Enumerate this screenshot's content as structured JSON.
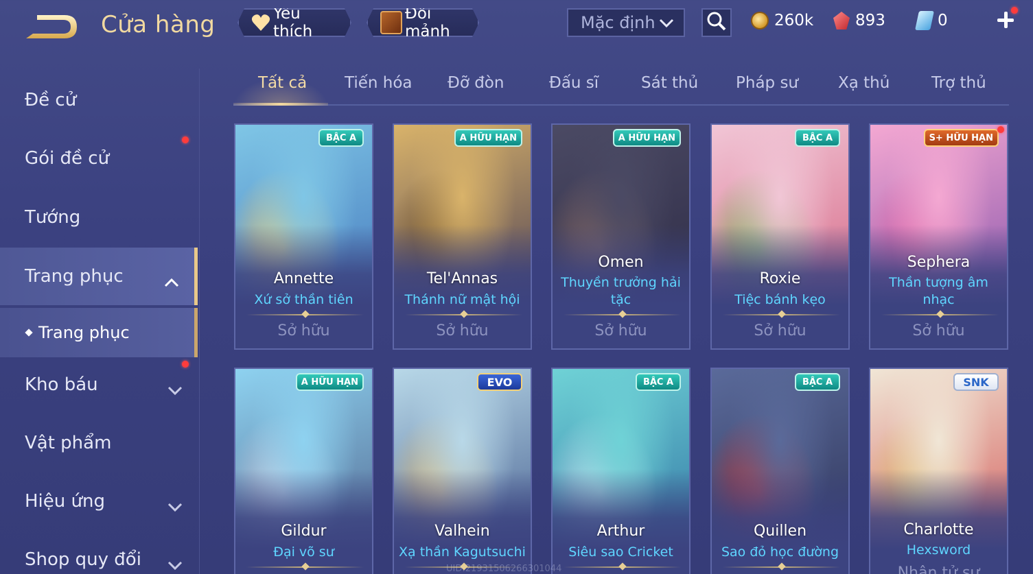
{
  "header": {
    "title": "Cửa hàng",
    "favorite_label": "Yêu thích",
    "shard_label": "Đổi mảnh",
    "sort_value": "Mặc định",
    "currencies": {
      "gold": "260k",
      "ruby": "893",
      "voucher": "0"
    }
  },
  "sidebar": {
    "items": [
      {
        "label": "Đề cử"
      },
      {
        "label": "Gói đề cử"
      },
      {
        "label": "Tướng"
      },
      {
        "label": "Trang phục"
      },
      {
        "label": "Trang phục"
      },
      {
        "label": "Kho báu"
      },
      {
        "label": "Vật phẩm"
      },
      {
        "label": "Hiệu ứng"
      },
      {
        "label": "Shop quy đổi"
      }
    ]
  },
  "tabs": [
    {
      "label": "Tất cả"
    },
    {
      "label": "Tiến hóa"
    },
    {
      "label": "Đỡ đòn"
    },
    {
      "label": "Đấu sĩ"
    },
    {
      "label": "Sát thủ"
    },
    {
      "label": "Pháp sư"
    },
    {
      "label": "Xạ thủ"
    },
    {
      "label": "Trợ thủ"
    }
  ],
  "cards": [
    {
      "hero": "Annette",
      "skin": "Xứ sở thần tiên",
      "status": "Sở hữu",
      "badge": "BẬC A",
      "art_colors": [
        "#7fc6e6",
        "#f0d27a",
        "#3e6fb8"
      ]
    },
    {
      "hero": "Tel'Annas",
      "skin": "Thánh nữ mật hội",
      "status": "Sở hữu",
      "badge": "A HỮU HẠN",
      "art_colors": [
        "#d9b36a",
        "#7a5a2c",
        "#3a3152"
      ]
    },
    {
      "hero": "Omen",
      "skin": "Thuyền trưởng hải tặc",
      "status": "Sở hữu",
      "badge": "A HỮU HẠN",
      "art_colors": [
        "#4b4a64",
        "#8a6c64",
        "#2a2742"
      ]
    },
    {
      "hero": "Roxie",
      "skin": "Tiệc bánh kẹo",
      "status": "Sở hữu",
      "badge": "BẬC A",
      "art_colors": [
        "#f1c6d6",
        "#7ab85a",
        "#d25a7a"
      ]
    },
    {
      "hero": "Sephera",
      "skin": "Thần tượng âm nhạc",
      "status": "Sở hữu",
      "badge": "S+ HỮU HẠN",
      "art_colors": [
        "#f4a8d2",
        "#e266a6",
        "#7a4aa6"
      ]
    },
    {
      "hero": "Gildur",
      "skin": "Đại võ sư",
      "status": "",
      "badge": "A HỮU HẠN",
      "art_colors": [
        "#8ed2f0",
        "#d0d6e6",
        "#4a5a84"
      ]
    },
    {
      "hero": "Valhein",
      "skin": "Xạ thần Kagutsuchi",
      "status": "",
      "badge": "EVO",
      "art_colors": [
        "#b8d8e8",
        "#e6c27a",
        "#3a5286"
      ]
    },
    {
      "hero": "Arthur",
      "skin": "Siêu sao Cricket",
      "status": "",
      "badge": "BẬC A",
      "art_colors": [
        "#6fd2d6",
        "#c8e6f0",
        "#2a6a9e"
      ]
    },
    {
      "hero": "Quillen",
      "skin": "Sao đỏ học đường",
      "status": "",
      "badge": "BẬC A",
      "art_colors": [
        "#5a6a9a",
        "#c23a3a",
        "#2a2e52"
      ]
    },
    {
      "hero": "Charlotte",
      "skin": "Hexsword",
      "status": "Nhân tử sư",
      "badge": "SNK",
      "art_colors": [
        "#f0e6d6",
        "#e0c070",
        "#d04a4a"
      ]
    }
  ],
  "watermark": "UID:21931506266301044",
  "colors": {
    "accent_gold": "#f3d9a0",
    "skin_name_blue": "#5fd6ff",
    "notification_red": "#ff3c3c"
  }
}
